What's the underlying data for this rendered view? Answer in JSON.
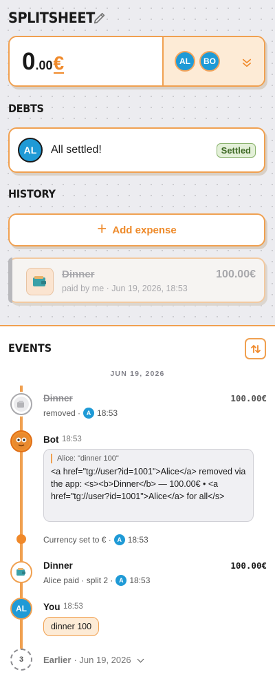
{
  "header": {
    "title": "SPLITSHEET",
    "edit_icon": "pencil-icon"
  },
  "balance": {
    "integer": "0",
    "decimal": ".00",
    "currency": "€",
    "participants": [
      "AL",
      "BO"
    ],
    "expand_icon": "chevrons-down-icon"
  },
  "debts": {
    "label": "DEBTS",
    "avatar": "AL",
    "text": "All settled!",
    "badge": "Settled"
  },
  "history": {
    "label": "HISTORY",
    "add_label": "Add expense",
    "expense": {
      "name": "Dinner",
      "meta": "paid by me · Jun 19, 2026, 18:53",
      "amount": "100.00€",
      "icon": "wallet-icon"
    }
  },
  "events": {
    "title": "EVENTS",
    "sort_icon": "sort-arrows-icon",
    "date": "JUN 19, 2026",
    "items": [
      {
        "title": "Dinner",
        "meta_prefix": "removed ·",
        "avatar": "A",
        "time": "18:53",
        "amount": "100.00€"
      },
      {
        "sender": "Bot",
        "time": "18:53",
        "quote": "Alice: \"dinner 100\"",
        "body": "<a href=\"tg://user?id=1001\">Alice</a> removed via the app: <s><b>Dinner</b> — 100.00€ • <a href=\"tg://user?id=1001\">Alice</a> for all</s>"
      },
      {
        "meta_prefix": "Currency set to € ·",
        "avatar": "A",
        "time": "18:53"
      },
      {
        "title": "Dinner",
        "meta_prefix": "Alice paid · split 2 ·",
        "avatar": "A",
        "time": "18:53",
        "amount": "100.00€"
      },
      {
        "sender": "You",
        "avatar": "AL",
        "time": "18:53",
        "body": "dinner 100"
      },
      {
        "count": "3",
        "label": "Earlier",
        "date": "· Jun 19, 2026"
      }
    ]
  },
  "colors": {
    "accent": "#f0a050",
    "avatar_blue": "#1f9ad6",
    "settled_green": "#8ab36d"
  }
}
